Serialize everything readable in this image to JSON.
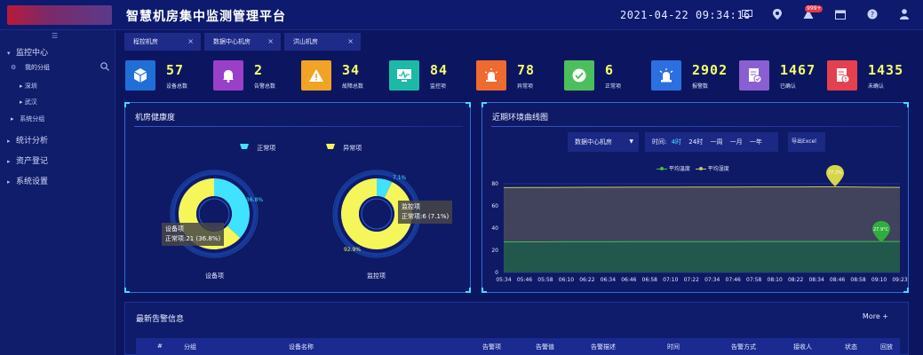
{
  "header": {
    "title": "智慧机房集中监测管理平台",
    "datetime": "2021-04-22 09:34:16",
    "notification_badge": "999+"
  },
  "sidebar": {
    "collapse_icon": "menu-icon",
    "items": [
      {
        "label": "监控中心",
        "expanded": true
      },
      {
        "label": "我的分组"
      },
      {
        "label": "深圳"
      },
      {
        "label": "武汉"
      },
      {
        "label": "系统分组"
      },
      {
        "label": "统计分析"
      },
      {
        "label": "资产登记"
      },
      {
        "label": "系统设置"
      }
    ]
  },
  "tabs": [
    {
      "label": "程控机房",
      "close": "×"
    },
    {
      "label": "数据中心机房",
      "close": "×"
    },
    {
      "label": "洪山机房",
      "close": "×"
    }
  ],
  "stats": [
    {
      "value": "57",
      "label": "设备总数",
      "color": "#1f6fd6",
      "icon": "cube-icon"
    },
    {
      "value": "2",
      "label": "告警总数",
      "color": "#9a3fc8",
      "icon": "bell-icon"
    },
    {
      "value": "34",
      "label": "故障总数",
      "color": "#f0a324",
      "icon": "warning-icon"
    },
    {
      "value": "84",
      "label": "监控项",
      "color": "#1cb9a6",
      "icon": "monitor-icon"
    },
    {
      "value": "78",
      "label": "异常项",
      "color": "#ee6a2f",
      "icon": "alarm-light-icon"
    },
    {
      "value": "6",
      "label": "正常项",
      "color": "#4cbf5c",
      "icon": "check-icon"
    },
    {
      "value": "2902",
      "label": "报警数",
      "color": "#2c6fe0",
      "icon": "siren-icon"
    },
    {
      "value": "1467",
      "label": "已确认",
      "color": "#8a5fd2",
      "icon": "doc-check-icon"
    },
    {
      "value": "1435",
      "label": "未确认",
      "color": "#e4404f",
      "icon": "doc-alert-icon"
    }
  ],
  "health_panel": {
    "title": "机房健康度",
    "legend": [
      {
        "label": "正常项",
        "color": "#3fe3ff"
      },
      {
        "label": "异常项",
        "color": "#f4f65a"
      }
    ]
  },
  "env_panel": {
    "title": "近期环境曲线图",
    "room_select": "数据中心机房",
    "time_label": "时间:",
    "ranges": [
      "4时",
      "24时",
      "一周",
      "一月",
      "一年"
    ],
    "active_range": "4时",
    "export_label": "导出Excel",
    "max_marker": "77.2%",
    "temp_marker": "27.9°C"
  },
  "chart_data": [
    {
      "type": "pie",
      "name": "设备项",
      "labels": [
        "正常项",
        "异常项"
      ],
      "values": [
        21,
        36
      ],
      "percent_label": "36.8%",
      "tooltip_title": "设备项",
      "tooltip_text": "正常项:21 (36.8%)",
      "colors": [
        "#3fe3ff",
        "#f4f65a"
      ]
    },
    {
      "type": "pie",
      "name": "监控项",
      "labels": [
        "正常项",
        "异常项"
      ],
      "values": [
        6,
        78
      ],
      "percent_labels": [
        "7.1%",
        "92.9%"
      ],
      "tooltip_title": "监控项",
      "tooltip_text": "正常项:6 (7.1%)",
      "colors": [
        "#3fe3ff",
        "#f4f65a"
      ]
    },
    {
      "type": "area",
      "ylim": [
        0,
        80
      ],
      "yticks": [
        0,
        20,
        40,
        60,
        80
      ],
      "categories": [
        "05:34",
        "05:46",
        "05:58",
        "06:10",
        "06:22",
        "06:34",
        "06:46",
        "06:58",
        "07:10",
        "07:22",
        "07:34",
        "07:46",
        "07:58",
        "08:10",
        "08:22",
        "08:34",
        "08:46",
        "08:58",
        "09:10",
        "09:23"
      ],
      "series": [
        {
          "name": "平均温度",
          "color": "#3fbf4f",
          "values": [
            27.5,
            27.6,
            27.6,
            27.7,
            27.7,
            27.7,
            27.8,
            27.8,
            27.8,
            27.8,
            27.8,
            27.8,
            27.9,
            27.9,
            27.9,
            27.9,
            27.9,
            27.9,
            27.9,
            27.9
          ]
        },
        {
          "name": "平均湿度",
          "color": "#c9c95a",
          "values": [
            76.5,
            76.6,
            76.6,
            76.7,
            76.8,
            76.8,
            76.9,
            76.9,
            76.9,
            77.0,
            77.0,
            77.0,
            77.1,
            77.1,
            77.1,
            77.2,
            77.2,
            77.0,
            76.8,
            76.7
          ]
        }
      ]
    }
  ],
  "alarm_panel": {
    "title": "最新告警信息",
    "more": "More +",
    "columns": [
      "#",
      "分组",
      "设备名称",
      "告警项",
      "告警值",
      "告警描述",
      "时间",
      "告警方式",
      "接收人",
      "状态",
      "回放"
    ]
  }
}
